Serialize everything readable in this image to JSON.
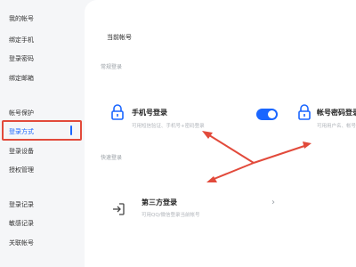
{
  "sidebar": {
    "items": [
      {
        "label": "我的帐号"
      },
      {
        "label": "绑定手机"
      },
      {
        "label": "登录密码"
      },
      {
        "label": "绑定邮箱"
      },
      {
        "label": "帐号保护"
      },
      {
        "label": "登录方式"
      },
      {
        "label": "登录设备"
      },
      {
        "label": "授权管理"
      },
      {
        "label": "登录记录"
      },
      {
        "label": "敏感记录"
      },
      {
        "label": "关联帐号"
      }
    ],
    "active_label": "登录方式"
  },
  "main": {
    "current_account_label": "当前帐号",
    "regular_login_label": "常规登录",
    "quick_login_label": "快速登录",
    "phone_login": {
      "title": "手机号登录",
      "desc": "可用短信验证、手机号+密码登录",
      "toggle_on": true
    },
    "password_login": {
      "title": "帐号密码登录",
      "desc": "可用用户名、帐号"
    },
    "third_party_login": {
      "title": "第三方登录",
      "desc": "可用QQ/微信登录当前帐号"
    }
  },
  "colors": {
    "accent": "#1a66ff",
    "highlight": "#e24a3b"
  }
}
